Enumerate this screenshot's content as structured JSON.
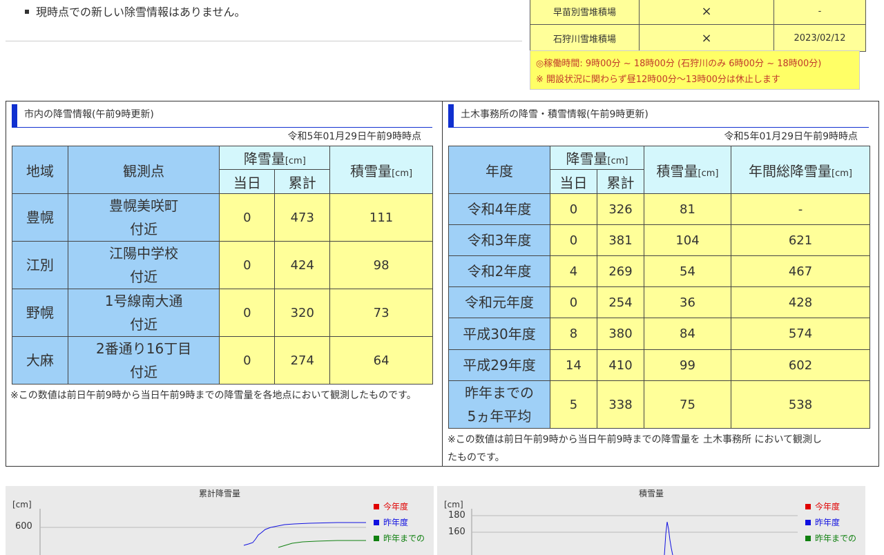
{
  "notice": {
    "text": "現時点での新しい除雪情報はありません。"
  },
  "yards": [
    {
      "name": "早苗別雪堆積場",
      "status": "×",
      "date": "-"
    },
    {
      "name": "石狩川雪堆積場",
      "status": "×",
      "date": "2023/02/12"
    }
  ],
  "hours": {
    "line1": "◎稼働時間: 9時00分 ~ 18時00分 (石狩川のみ 6時00分 ~ 18時00分)",
    "line2": "※ 開設状況に関わらず昼12時00分〜13時00分は休止します"
  },
  "left_panel": {
    "title": "市内の降雪情報(午前9時更新)",
    "date": "令和5年01月29日午前9時時点",
    "headers": {
      "area": "地域",
      "point": "観測点",
      "snowfall": "降雪量",
      "unit": "[cm]",
      "today": "当日",
      "total": "累計",
      "depth": "積雪量"
    },
    "rows": [
      {
        "area": "豊幌",
        "point1": "豊幌美咲町",
        "point2": "付近",
        "today": "0",
        "total": "473",
        "depth": "111"
      },
      {
        "area": "江別",
        "point1": "江陽中学校",
        "point2": "付近",
        "today": "0",
        "total": "424",
        "depth": "98"
      },
      {
        "area": "野幌",
        "point1": "1号線南大通",
        "point2": "付近",
        "today": "0",
        "total": "320",
        "depth": "73"
      },
      {
        "area": "大麻",
        "point1": "2番通り16丁目",
        "point2": "付近",
        "today": "0",
        "total": "274",
        "depth": "64"
      }
    ],
    "note": "※この数値は前日午前9時から当日午前9時までの降雪量を各地点において観測したものです。"
  },
  "right_panel": {
    "title": "土木事務所の降雪・積雪情報(午前9時更新)",
    "date": "令和5年01月29日午前9時時点",
    "headers": {
      "year": "年度",
      "snowfall": "降雪量",
      "unit": "[cm]",
      "today": "当日",
      "total": "累計",
      "depth": "積雪量",
      "annual": "年間総降雪量"
    },
    "rows": [
      {
        "year": "令和4年度",
        "today": "0",
        "total": "326",
        "depth": "81",
        "annual": "-"
      },
      {
        "year": "令和3年度",
        "today": "0",
        "total": "381",
        "depth": "104",
        "annual": "621"
      },
      {
        "year": "令和2年度",
        "today": "4",
        "total": "269",
        "depth": "54",
        "annual": "467"
      },
      {
        "year": "令和元年度",
        "today": "0",
        "total": "254",
        "depth": "36",
        "annual": "428"
      },
      {
        "year": "平成30年度",
        "today": "8",
        "total": "380",
        "depth": "84",
        "annual": "574"
      },
      {
        "year": "平成29年度",
        "today": "14",
        "total": "410",
        "depth": "99",
        "annual": "602"
      }
    ],
    "avg": {
      "line1": "昨年までの",
      "line2": "5ヵ年平均",
      "today": "5",
      "total": "338",
      "depth": "75",
      "annual": "538"
    },
    "note1": "※この数値は前日午前9時から当日午前9時までの降雪量を 土木事務所 において観測し",
    "note2": "たものです。"
  },
  "charts": [
    {
      "title": "累計降雪量",
      "unit": "[cm]",
      "ticks": [
        "600"
      ],
      "legend": [
        "今年度",
        "昨年度",
        "昨年までの"
      ]
    },
    {
      "title": "積雪量",
      "unit": "[cm]",
      "ticks": [
        "180",
        "160"
      ],
      "legend": [
        "今年度",
        "昨年度",
        "昨年までの"
      ]
    }
  ],
  "colors": {
    "this_year": "#e00000",
    "last_year": "#1010e0",
    "avg": "#108010"
  }
}
